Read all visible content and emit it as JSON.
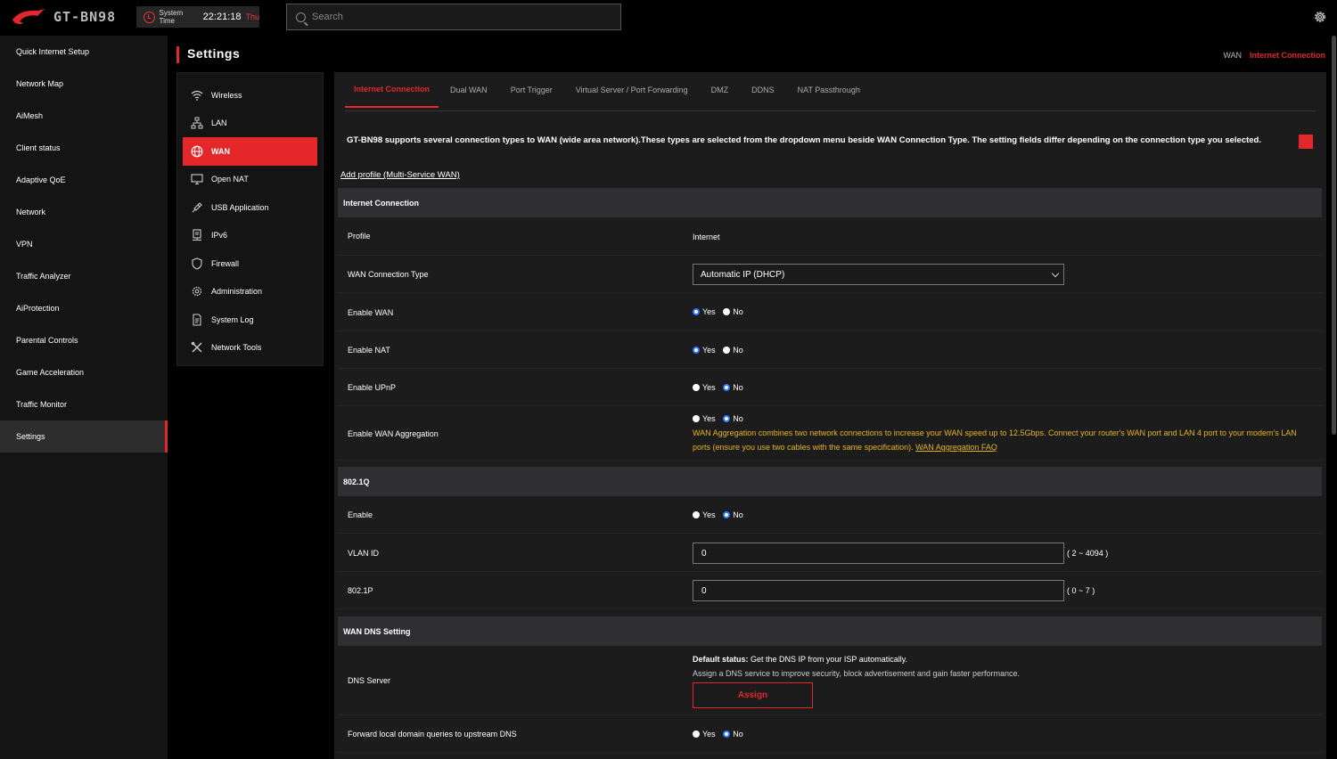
{
  "app": {
    "model": "GT-BN98",
    "system_time_label": "System Time",
    "system_time": "22:21:18",
    "day": "Thu",
    "search_placeholder": "Search"
  },
  "leftnav": {
    "items": [
      {
        "label": "Quick Internet Setup"
      },
      {
        "label": "Network Map"
      },
      {
        "label": "AiMesh"
      },
      {
        "label": "Client status"
      },
      {
        "label": "Adaptive QoE"
      },
      {
        "label": "Network"
      },
      {
        "label": "VPN"
      },
      {
        "label": "Traffic Analyzer"
      },
      {
        "label": "AiProtection"
      },
      {
        "label": "Parental Controls"
      },
      {
        "label": "Game Acceleration"
      },
      {
        "label": "Traffic Monitor"
      },
      {
        "label": "Settings"
      }
    ],
    "active_index": 12
  },
  "page": {
    "title": "Settings",
    "breadcrumb": [
      "WAN",
      "Internet Connection"
    ]
  },
  "subnav": {
    "items": [
      {
        "label": "Wireless",
        "icon": "wifi-icon"
      },
      {
        "label": "LAN",
        "icon": "lan-icon"
      },
      {
        "label": "WAN",
        "icon": "globe-icon"
      },
      {
        "label": "Open NAT",
        "icon": "monitor-icon"
      },
      {
        "label": "USB Application",
        "icon": "usb-icon"
      },
      {
        "label": "IPv6",
        "icon": "ipv6-icon"
      },
      {
        "label": "Firewall",
        "icon": "shield-icon"
      },
      {
        "label": "Administration",
        "icon": "gear-icon"
      },
      {
        "label": "System Log",
        "icon": "document-icon"
      },
      {
        "label": "Network Tools",
        "icon": "tools-icon"
      }
    ],
    "active_index": 2
  },
  "tabs": {
    "items": [
      {
        "label": "Internet Connection"
      },
      {
        "label": "Dual WAN"
      },
      {
        "label": "Port Trigger"
      },
      {
        "label": "Virtual Server / Port Forwarding"
      },
      {
        "label": "DMZ"
      },
      {
        "label": "DDNS"
      },
      {
        "label": "NAT Passthrough"
      }
    ],
    "active_index": 0
  },
  "content": {
    "description": "GT-BN98 supports several connection types to WAN (wide area network).These types are selected from the dropdown menu beside WAN Connection Type. The setting fields differ depending on the connection type you selected.",
    "add_profile": "Add profile (Multi-Service WAN)",
    "yes": "Yes",
    "no": "No",
    "sections": {
      "internet_connection": "Internet Connection",
      "dot1q": "802.1Q",
      "wan_dns": "WAN DNS Setting"
    },
    "profile": {
      "label": "Profile",
      "value": "Internet"
    },
    "wan_type": {
      "label": "WAN Connection Type",
      "value": "Automatic IP (DHCP)"
    },
    "enable_wan": {
      "label": "Enable WAN",
      "selected": "Yes"
    },
    "enable_nat": {
      "label": "Enable NAT",
      "selected": "Yes"
    },
    "enable_upnp": {
      "label": "Enable UPnP",
      "selected": "No"
    },
    "wan_aggregation": {
      "label": "Enable WAN Aggregation",
      "selected": "No",
      "note": "WAN Aggregation combines two network connections to increase your WAN speed up to 12.5Gbps. Connect your router's WAN port and LAN 4 port to your modem's LAN ports (ensure you use two cables with the same specification).",
      "faq": "WAN Aggregation FAQ"
    },
    "dot1q_enable": {
      "label": "Enable",
      "selected": "No"
    },
    "vlan_id": {
      "label": "VLAN ID",
      "value": "0",
      "range": "( 2 ~ 4094 )"
    },
    "dot1p": {
      "label": "802.1P",
      "value": "0",
      "range": "( 0 ~ 7 )"
    },
    "dns_server": {
      "label": "DNS Server",
      "status_label": "Default status:",
      "status_text": " Get the DNS IP from your ISP automatically.",
      "hint": "Assign a DNS service to improve security, block advertisement and gain faster performance.",
      "button": "Assign"
    },
    "forward_local": {
      "label": "Forward local domain queries to upstream DNS",
      "selected": "No"
    }
  },
  "colors": {
    "accent": "#e3272b",
    "note": "#e6b422",
    "radio_on": "#2979ff"
  }
}
